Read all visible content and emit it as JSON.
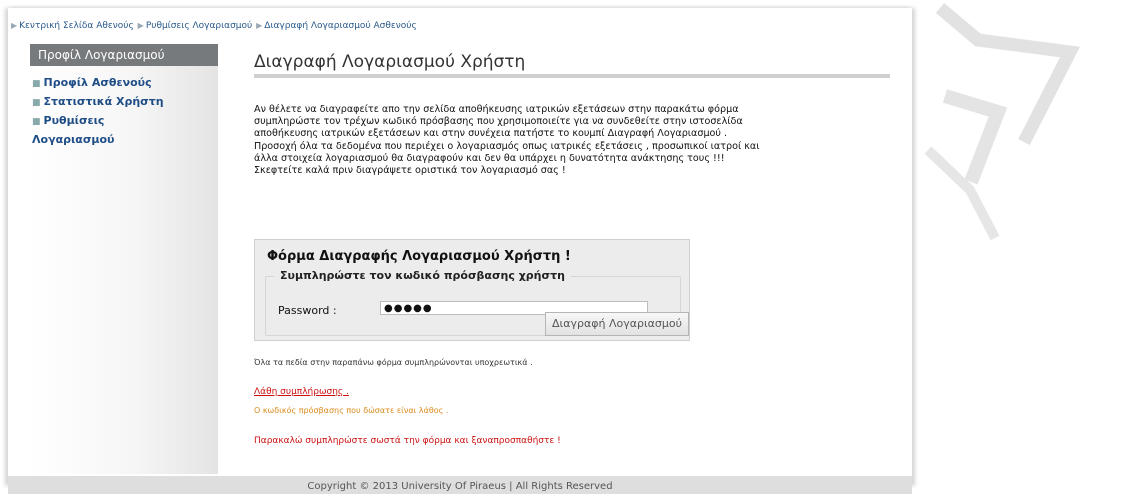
{
  "breadcrumb": {
    "items": [
      "Κεντρική Σελίδα Αθενούς",
      "Ρυθμίσεις Λογαριασμού",
      "Διαγραφή Λογαριασμού Ασθενούς"
    ]
  },
  "sidebar": {
    "header": "Προφίλ Λογαριασμού",
    "items": [
      "Προφίλ Ασθενούς",
      "Στατιστικά Χρήστη",
      "Ρυθμίσεις",
      "Λογαριασμού"
    ]
  },
  "main": {
    "title": "Διαγραφή Λογαριασμού Χρήστη",
    "intro_lines": [
      "Αν θέλετε να διαγραφείτε απο την σελίδα αποθήκευσης ιατρικών εξετάσεων στην παρακάτω φόρμα",
      "συμπληρώστε τον τρέχων κωδικό πρόσβασης που χρησιμοποιείτε για να συνδεθείτε στην ιστοσελίδα",
      "αποθήκευσης ιατρικών εξετάσεων και στην συνέχεια πατήστε το κουμπί Διαγραφή Λογαριασμού .",
      "Προσοχή όλα τα δεδομένα που περιέχει ο λογαριασμός οπως ιατρικές εξετάσεις , προσωπικοί ιατροί και",
      "άλλα στοιχεία λογαριασμού θα διαγραφούν και δεν θα υπάρχει η δυνατότητα ανάκτησης τους !!!",
      "Σκεφτείτε καλά πριν διαγράψετε οριστικά τον λογαριασμό σας !"
    ],
    "form": {
      "title": "Φόρμα Διαγραφής Λογαριασμού Χρήστη !",
      "legend": "Συμπληρώστε τον κωδικό πρόσβασης χρήστη",
      "password_label": "Password :",
      "password_value": "●●●●●",
      "delete_button": "Διαγραφή Λογαριασμού"
    },
    "required_note": "Όλα τα πεδία στην παραπάνω φόρμα συμπληρώνονται υποχρεωτικά .",
    "error_heading": "Λάθη συμπλήρωσης .",
    "error_message": "Ο κωδικός πρόσβασης που δώσατε είναι λάθος .",
    "error_final": "Παρακαλώ συμπληρώστε σωστά την φόρμα και ξαναπροσπαθήστε !"
  },
  "footer": {
    "text": "Copyright © 2013 University Of Piraeus | All Rights Reserved"
  },
  "colors": {
    "link": "#1f4d86",
    "error": "#cc1111",
    "warning": "#d98a1a",
    "sidebar_header": "#777a7c"
  }
}
